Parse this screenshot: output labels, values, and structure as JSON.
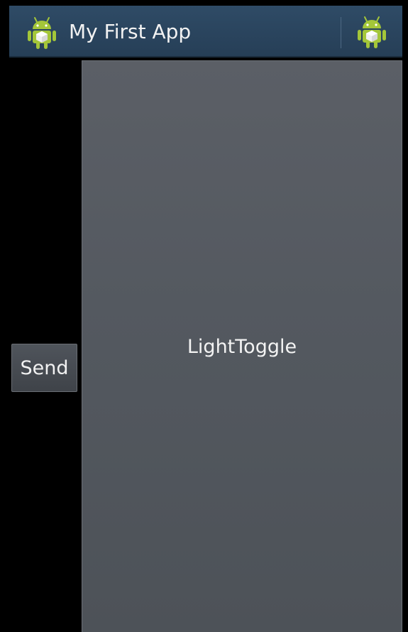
{
  "action_bar": {
    "title": "My First App",
    "app_icon": "android-robot-icon",
    "overflow_action_icon": "android-robot-icon"
  },
  "main": {
    "send_label": "Send",
    "toggle_label": "LightToggle"
  },
  "colors": {
    "action_bar_bg": "#2c4760",
    "android_green": "#a4c639",
    "button_bg": "#4a4f56",
    "toggle_bg": "#555a61",
    "background": "#000000"
  }
}
